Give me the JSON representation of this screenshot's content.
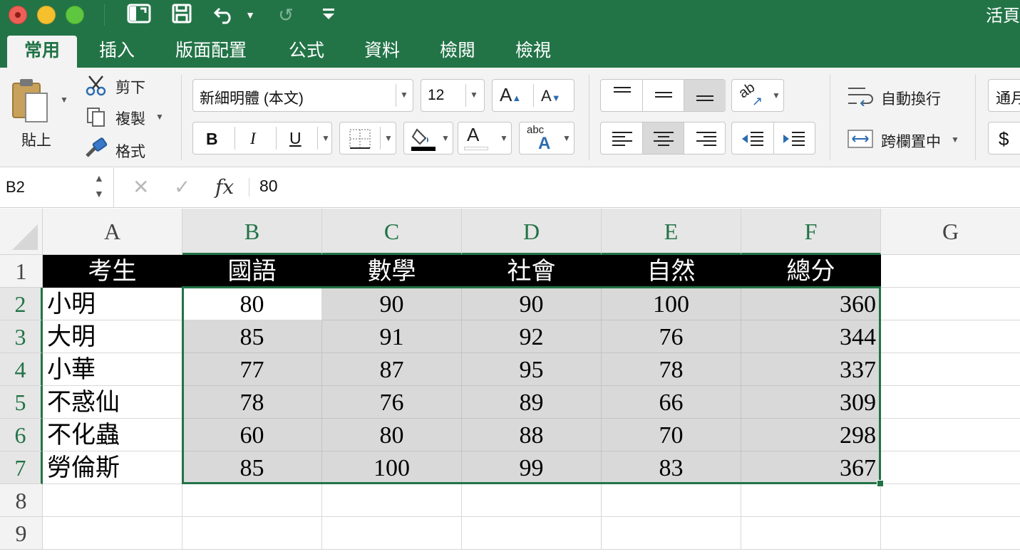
{
  "app": {
    "document_title": "活頁",
    "colors": {
      "accent": "#217346",
      "titlebar": "#227447",
      "selection_border": "#217346",
      "header_row_bg": "#000000",
      "data_shade": "#d9d9d9"
    }
  },
  "quick_access": [
    "sidebar-toggle-icon",
    "save-icon",
    "undo-icon",
    "redo-icon",
    "customize-icon"
  ],
  "tabs": [
    {
      "label": "常用",
      "active": true
    },
    {
      "label": "插入"
    },
    {
      "label": "版面配置"
    },
    {
      "label": "公式"
    },
    {
      "label": "資料"
    },
    {
      "label": "檢閱"
    },
    {
      "label": "檢視"
    }
  ],
  "ribbon": {
    "paste_label": "貼上",
    "cut_label": "剪下",
    "copy_label": "複製",
    "format_painter_label": "格式",
    "font_name": "新細明體 (本文)",
    "font_size": "12",
    "bold": "B",
    "italic": "I",
    "underline": "U",
    "wrap_text_label": "自動換行",
    "merge_center_label": "跨欄置中",
    "number_format": "通月",
    "currency": "$"
  },
  "formula_bar": {
    "name_box": "B2",
    "fx": "fx",
    "value": "80"
  },
  "sheet": {
    "columns": [
      "A",
      "B",
      "C",
      "D",
      "E",
      "F",
      "G"
    ],
    "rows": [
      "1",
      "2",
      "3",
      "4",
      "5",
      "6",
      "7",
      "8",
      "9"
    ],
    "selected_columns": [
      "B",
      "C",
      "D",
      "E",
      "F"
    ],
    "selected_rows": [
      "2",
      "3",
      "4",
      "5",
      "6",
      "7"
    ],
    "active_cell": "B2",
    "header": [
      "考生",
      "國語",
      "數學",
      "社會",
      "自然",
      "總分"
    ],
    "data": [
      [
        "小明",
        "80",
        "90",
        "90",
        "100",
        "360"
      ],
      [
        "大明",
        "85",
        "91",
        "92",
        "76",
        "344"
      ],
      [
        "小華",
        "77",
        "87",
        "95",
        "78",
        "337"
      ],
      [
        "不惑仙",
        "78",
        "76",
        "89",
        "66",
        "309"
      ],
      [
        "不化蟲",
        "60",
        "80",
        "88",
        "70",
        "298"
      ],
      [
        "勞倫斯",
        "85",
        "100",
        "99",
        "83",
        "367"
      ]
    ]
  }
}
